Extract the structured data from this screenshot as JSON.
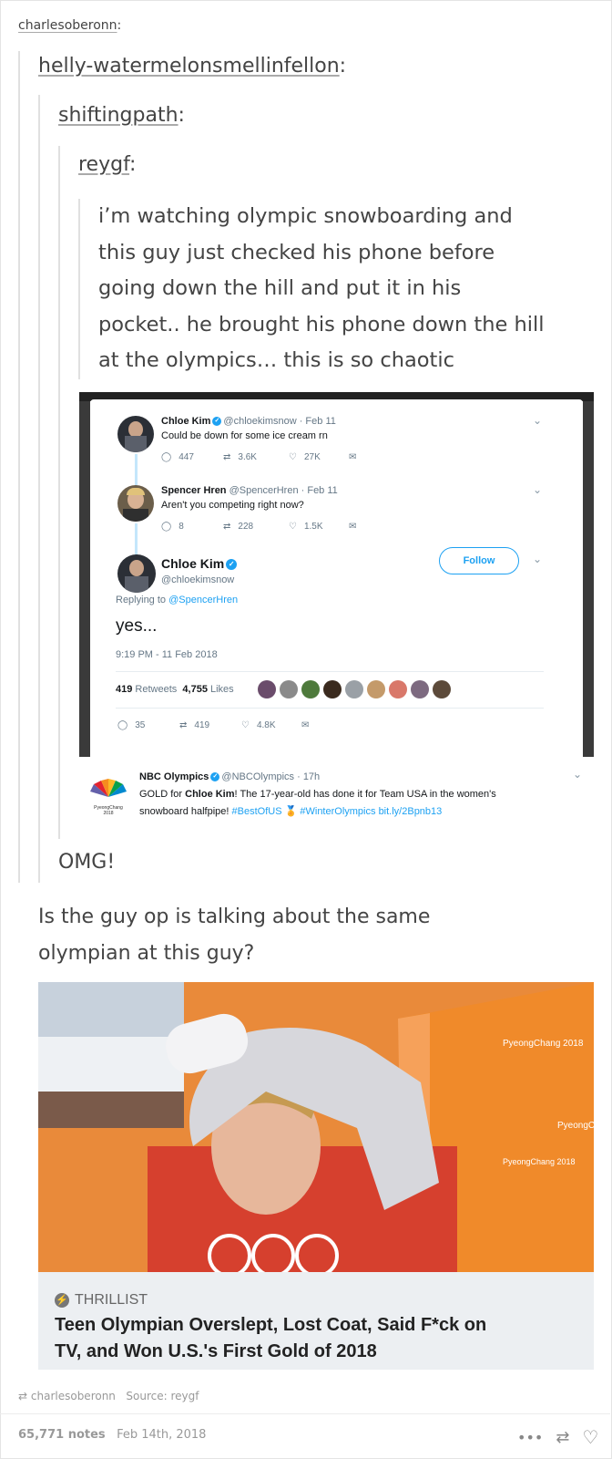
{
  "post": {
    "reblogs": [
      {
        "user": "charlesoberonn"
      },
      {
        "user": "helly-watermelonsmellinfellon"
      },
      {
        "user": "shiftingpath"
      },
      {
        "user": "reygf"
      }
    ],
    "colon": ":",
    "original_text": [
      "i’m watching olympic snowboarding and",
      "this guy just checked his phone before",
      "going down the hill and put it in his",
      "pocket.. he brought his phone down the hill",
      "at the olympics… this is so chaotic"
    ],
    "shiftingpath_reply": "OMG!",
    "helly_reply": [
      "Is the guy op is talking about the same",
      "olympian at this guy?"
    ]
  },
  "tweets": {
    "t1": {
      "name": "Chloe Kim",
      "handle": "@chloekimsnow · Feb 11",
      "text": "Could be down for some ice cream rn",
      "replies": "447",
      "retweets": "3.6K",
      "likes": "27K"
    },
    "t2": {
      "name": "Spencer Hren",
      "handle": "@SpencerHren · Feb 11",
      "text": "Aren't you competing right now?",
      "replies": "8",
      "retweets": "228",
      "likes": "1.5K"
    },
    "t3": {
      "name": "Chloe Kim",
      "handle": "@chloekimsnow",
      "follow": "Follow",
      "replying_prefix": "Replying to",
      "replying_to": "@SpencerHren",
      "text": "yes...",
      "time": "9:19 PM - 11 Feb 2018",
      "retweets_count": "419",
      "retweets_label": "Retweets",
      "likes_count": "4,755",
      "likes_label": "Likes",
      "replies": "35",
      "retweets": "419",
      "likes": "4.8K"
    },
    "t4": {
      "name": "NBC Olympics",
      "handle": "@NBCOlympics · 17h",
      "text_a": "GOLD for ",
      "text_b": "Chloe Kim",
      "text_c": "! The 17-year-old has done it for Team USA in the women's",
      "text_d": "snowboard halfpipe! ",
      "hashtag1": "#BestOfUS",
      "hashtag2": "#WinterOlympics",
      "link": "bit.ly/2Bpnb13",
      "logo_caption": "PyeongChang 2018"
    }
  },
  "article": {
    "source": "THRILLIST",
    "title_line1": "Teen Olympian Overslept, Lost Coat, Said F*ck on",
    "title_line2": "TV, and Won U.S.'s First Gold of 2018"
  },
  "banner_texts": [
    "PyeongChang 2018",
    "PyeongC",
    "PyeongChang 2018"
  ],
  "footer": {
    "reblogged_from": "charlesoberonn",
    "source_label": "Source:",
    "source": "reygf",
    "notes": "65,771 notes",
    "date": "Feb 14th, 2018"
  },
  "colors": {
    "twitter_blue": "#1da1f2",
    "text": "#444444",
    "quote_bar": "#e0e0e0"
  }
}
